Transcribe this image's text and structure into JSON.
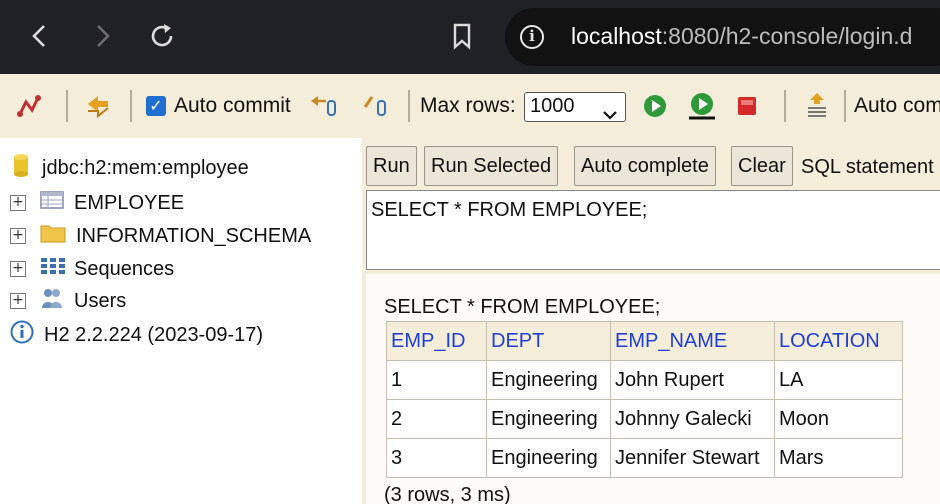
{
  "browser": {
    "url_host": "localhost",
    "url_rest": ":8080/h2-console/login.d",
    "icons": [
      "back-icon",
      "forward-icon",
      "reload-icon",
      "bookmark-icon",
      "site-info-icon"
    ]
  },
  "toolbar": {
    "auto_commit_label": "Auto commit",
    "auto_commit_checked": true,
    "max_rows_label": "Max rows:",
    "max_rows_value": "1000",
    "auto_complete_label": "Auto com"
  },
  "tree": {
    "connection": "jdbc:h2:mem:employee",
    "items": [
      {
        "label": "EMPLOYEE",
        "icon": "table-icon"
      },
      {
        "label": "INFORMATION_SCHEMA",
        "icon": "folder-icon"
      },
      {
        "label": "Sequences",
        "icon": "sequences-icon"
      },
      {
        "label": "Users",
        "icon": "users-icon"
      }
    ],
    "version": "H2 2.2.224 (2023-09-17)"
  },
  "editor": {
    "buttons": [
      "Run",
      "Run Selected",
      "Auto complete",
      "Clear"
    ],
    "sql_label": "SQL statement",
    "sql_text": "SELECT * FROM EMPLOYEE;"
  },
  "results": {
    "query": "SELECT * FROM EMPLOYEE;",
    "columns": [
      "EMP_ID",
      "DEPT",
      "EMP_NAME",
      "LOCATION"
    ],
    "rows": [
      [
        "1",
        "Engineering",
        "John Rupert",
        "LA"
      ],
      [
        "2",
        "Engineering",
        "Johnny Galecki",
        "Moon"
      ],
      [
        "3",
        "Engineering",
        "Jennifer Stewart",
        "Mars"
      ]
    ],
    "footer": "(3 rows, 3 ms)"
  },
  "colors": {
    "panel_bg": "#f4edd9",
    "header_link": "#1f3fd6",
    "browser_bg": "#202124"
  }
}
